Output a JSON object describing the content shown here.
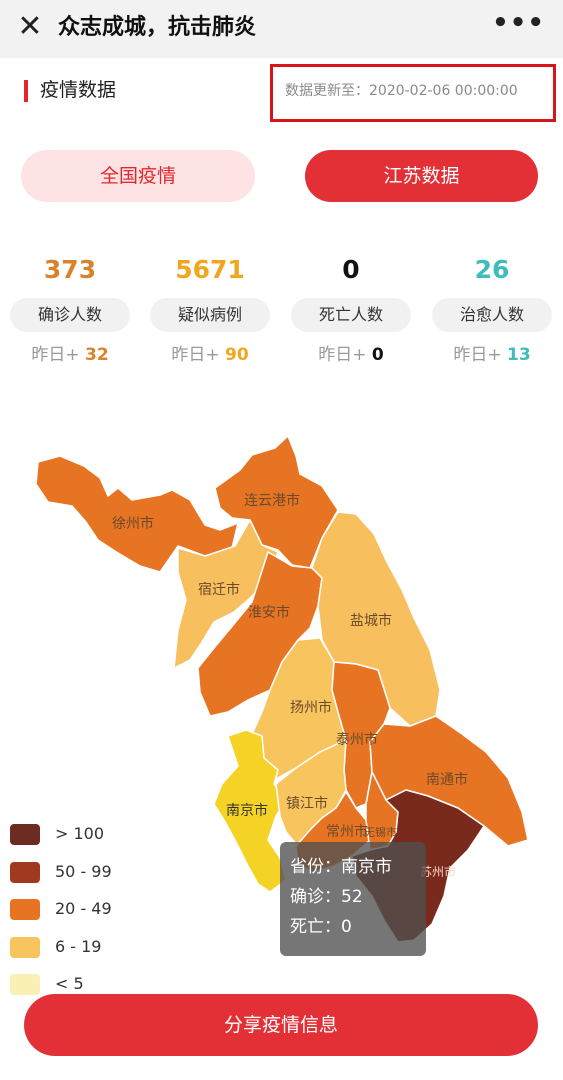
{
  "header": {
    "title": "众志成城，抗击肺炎",
    "close_icon": "✕",
    "more_icon": "•••"
  },
  "section": {
    "title": "疫情数据",
    "update_text": "数据更新至：2020-02-06 00:00:00"
  },
  "tabs": {
    "national": "全国疫情",
    "jiangsu": "江苏数据"
  },
  "stats": [
    {
      "value": "373",
      "label": "确诊人数",
      "delta_prefix": "昨日+ ",
      "delta": "32",
      "color": "#d9822b"
    },
    {
      "value": "5671",
      "label": "疑似病例",
      "delta_prefix": "昨日+ ",
      "delta": "90",
      "color": "#f0a61e"
    },
    {
      "value": "0",
      "label": "死亡人数",
      "delta_prefix": "昨日+ ",
      "delta": "0",
      "color": "#111111"
    },
    {
      "value": "26",
      "label": "治愈人数",
      "delta_prefix": "昨日+ ",
      "delta": "13",
      "color": "#3fbcbc"
    }
  ],
  "map": {
    "cities": [
      {
        "name": "徐州市",
        "color": "#e77423"
      },
      {
        "name": "连云港市",
        "color": "#e77423"
      },
      {
        "name": "宿迁市",
        "color": "#f7bf5e"
      },
      {
        "name": "淮安市",
        "color": "#e77423"
      },
      {
        "name": "盐城市",
        "color": "#f7bf5e"
      },
      {
        "name": "扬州市",
        "color": "#f7c45e"
      },
      {
        "name": "泰州市",
        "color": "#e77423"
      },
      {
        "name": "南通市",
        "color": "#e77423"
      },
      {
        "name": "南京市",
        "color": "#f5d326"
      },
      {
        "name": "镇江市",
        "color": "#f7c45e"
      },
      {
        "name": "常州市",
        "color": "#e77423"
      },
      {
        "name": "无锡市",
        "color": "#e77423"
      },
      {
        "name": "苏州市",
        "color": "#7a2a1c"
      }
    ]
  },
  "legend": [
    {
      "label": "> 100",
      "color": "#6e2b22"
    },
    {
      "label": "50 - 99",
      "color": "#a0391f"
    },
    {
      "label": "20 - 49",
      "color": "#e77423"
    },
    {
      "label": "6 - 19",
      "color": "#f7c45e"
    },
    {
      "label": "< 5",
      "color": "#fbf0b3"
    }
  ],
  "tooltip": {
    "province": "省份：南京市",
    "confirmed": "确诊：52",
    "deaths": "死亡：0"
  },
  "share_button": "分享疫情信息"
}
